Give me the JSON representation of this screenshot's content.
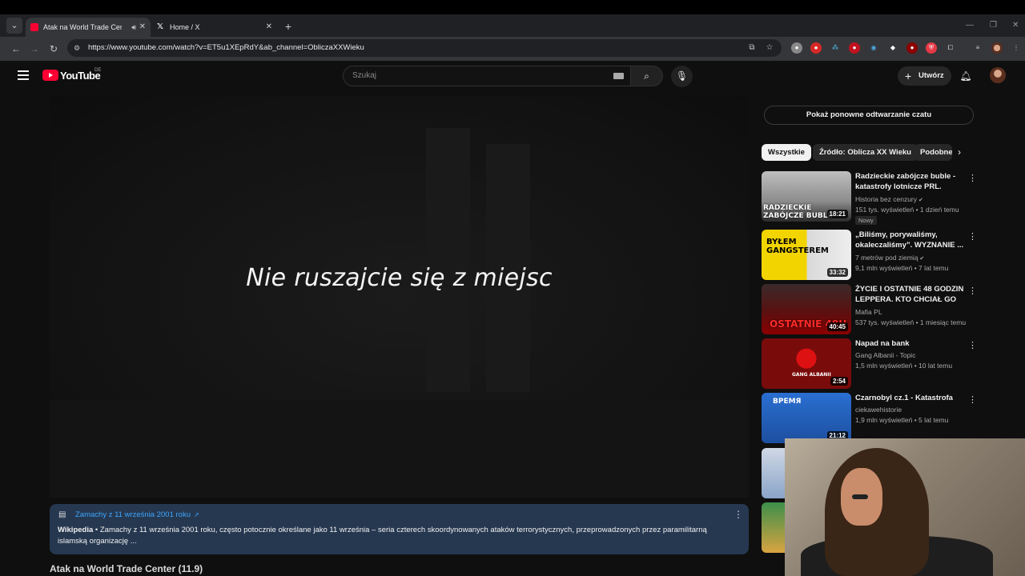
{
  "browser": {
    "tabs": [
      {
        "title": "Atak na World Trade Center",
        "active": true
      },
      {
        "title": "Home / X",
        "active": false
      }
    ],
    "url": "https://www.youtube.com/watch?v=ET5u1XEpRdY&ab_channel=ObliczaXXWieku"
  },
  "youtube": {
    "brand": "YouTube",
    "region": "DE",
    "search_placeholder": "Szukaj",
    "create_label": "Utwórz"
  },
  "video": {
    "subtitle": "Nie ruszajcie się z miejsc"
  },
  "info_card": {
    "link": "Zamachy z 11 września 2001 roku",
    "source": "Wikipedia",
    "text": " • Zamachy z 11 września 2001 roku, często potocznie określane jako 11 września – seria czterech skoordynowanych ataków terrorystycznych, przeprowadzonych przez paramilitarną islamską organizację ..."
  },
  "video_title_peek": "Atak na World Trade Center (11.9)",
  "sidebar": {
    "chat_replay": "Pokaż ponowne odtwarzanie czatu",
    "chips": [
      "Wszystkie",
      "Źródło: Oblicza XX Wieku",
      "Podobne"
    ],
    "recommendations": [
      {
        "title": "Radzieckie zabójcze buble - katastrofy lotnicze PRL. Histor...",
        "channel": "Historia bez cenzury",
        "verified": true,
        "stats": "151 tys. wyświetleń • 1 dzień temu",
        "badge": "Nowy",
        "duration": "18:21",
        "thumb_text": "RADZIECKIE ZABÓJCZE BUBLE"
      },
      {
        "title": "„Biliśmy, porywaliśmy, okaleczaliśmy”. WYZNANIE ...",
        "channel": "7 metrów pod ziemią",
        "verified": true,
        "stats": "9,1 mln wyświetleń • 7 lat temu",
        "badge": "",
        "duration": "33:32",
        "thumb_text": "BYŁEM GANGSTEREM"
      },
      {
        "title": "ŻYCIE I OSTATNIE 48 GODZIN LEPPERA. KTO CHCIAŁ GO ...",
        "channel": "Mafia PL",
        "verified": false,
        "stats": "537 tys. wyświetleń • 1 miesiąc temu",
        "badge": "",
        "duration": "40:45",
        "thumb_text": "OSTATNIE 48H"
      },
      {
        "title": "Napad na bank",
        "channel": "Gang Albanii - Topic",
        "verified": false,
        "stats": "1,5 mln wyświetleń • 10 lat temu",
        "badge": "",
        "duration": "2:54",
        "thumb_text": "GANG ALBANII"
      },
      {
        "title": "Czarnobyl cz.1 - Katastrofa",
        "channel": "ciekawehistorie",
        "verified": false,
        "stats": "1,9 mln wyświetleń • 5 lat temu",
        "badge": "",
        "duration": "21:12",
        "thumb_text": "ВРЕМЯ"
      }
    ]
  }
}
